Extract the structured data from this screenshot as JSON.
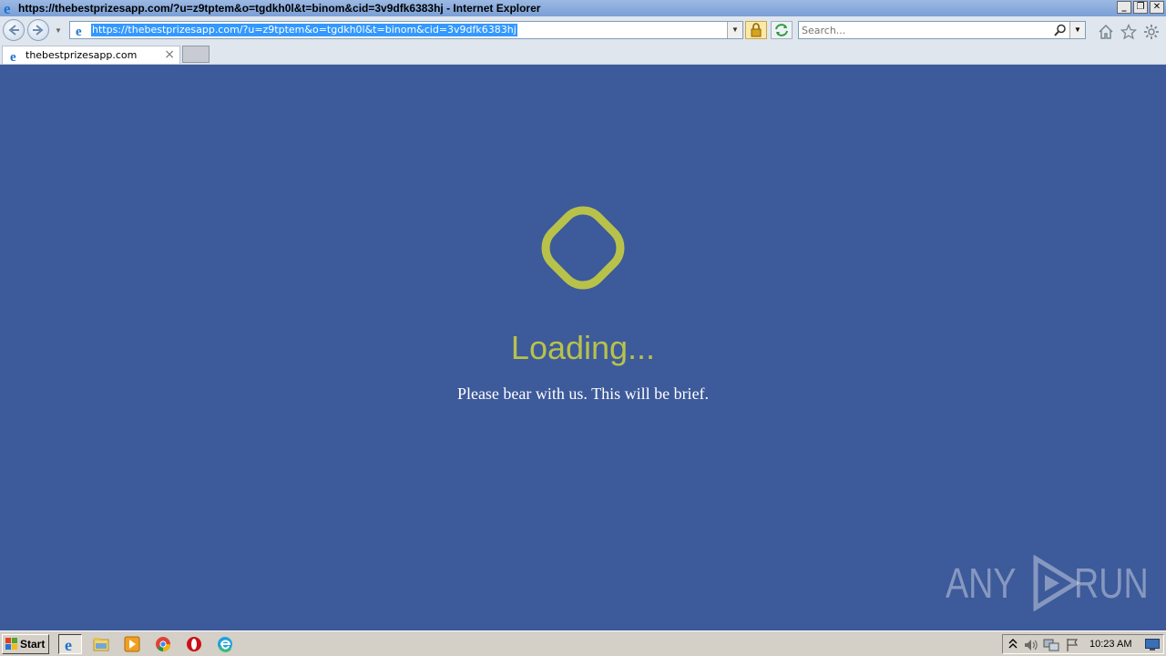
{
  "window": {
    "title": "https://thebestprizesapp.com/?u=z9tptem&o=tgdkh0l&t=binom&cid=3v9dfk6383hj - Internet Explorer",
    "minimize_label": "_",
    "maximize_label": "❐",
    "close_label": "✕"
  },
  "navbar": {
    "url": "https://thebestprizesapp.com/?u=z9tptem&o=tgdkh0l&t=binom&cid=3v9dfk6383hj",
    "search_placeholder": "Search..."
  },
  "tabs": [
    {
      "label": "thebestprizesapp.com",
      "close": "×"
    }
  ],
  "content": {
    "heading": "Loading...",
    "message": "Please bear with us. This will be brief.",
    "spinner_color": "#b8c24a",
    "background_color": "#3d5a9a"
  },
  "watermark": {
    "left": "ANY",
    "right": "RUN"
  },
  "taskbar": {
    "start_label": "Start",
    "clock": "10:23 AM",
    "pinned": [
      "internet-explorer-icon",
      "file-explorer-icon",
      "media-player-icon",
      "chrome-icon",
      "opera-icon",
      "edge-icon"
    ]
  }
}
